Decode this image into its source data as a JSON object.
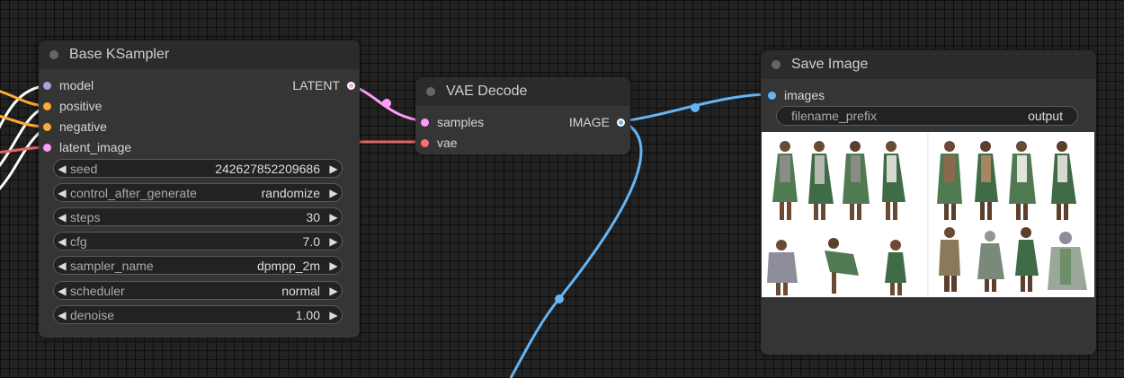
{
  "colors": {
    "canvas": "#222222",
    "node_body": "#353535",
    "node_title": "#2b2b2b",
    "model": "#b39ddb",
    "clip": "#ffa931",
    "latent": "#ff9cf9",
    "vae": "#ff6e6e",
    "image": "#64b5f6"
  },
  "nodes": {
    "ksampler": {
      "title": "Base KSampler",
      "inputs": [
        {
          "label": "model",
          "color": "#b39ddb"
        },
        {
          "label": "positive",
          "color": "#ffa931"
        },
        {
          "label": "negative",
          "color": "#ffa931"
        },
        {
          "label": "latent_image",
          "color": "#ff9cf9"
        }
      ],
      "output": {
        "label": "LATENT",
        "color": "#ff9cf9"
      },
      "widgets": [
        {
          "label": "seed",
          "value": "242627852209686"
        },
        {
          "label": "control_after_generate",
          "value": "randomize"
        },
        {
          "label": "steps",
          "value": "30"
        },
        {
          "label": "cfg",
          "value": "7.0"
        },
        {
          "label": "sampler_name",
          "value": "dpmpp_2m"
        },
        {
          "label": "scheduler",
          "value": "normal"
        },
        {
          "label": "denoise",
          "value": "1.00"
        }
      ]
    },
    "vae_decode": {
      "title": "VAE Decode",
      "inputs": [
        {
          "label": "samples",
          "color": "#ff9cf9"
        },
        {
          "label": "vae",
          "color": "#ff6e6e"
        }
      ],
      "output": {
        "label": "IMAGE",
        "color": "#64b5f6"
      }
    },
    "save_image": {
      "title": "Save Image",
      "input": {
        "label": "images",
        "color": "#64b5f6"
      },
      "widget": {
        "label": "filename_prefix",
        "value": "output"
      },
      "preview": {
        "description_icon": "character-sheet-preview-image"
      }
    }
  },
  "icons": {
    "decrement": "◀",
    "increment": "▶"
  }
}
